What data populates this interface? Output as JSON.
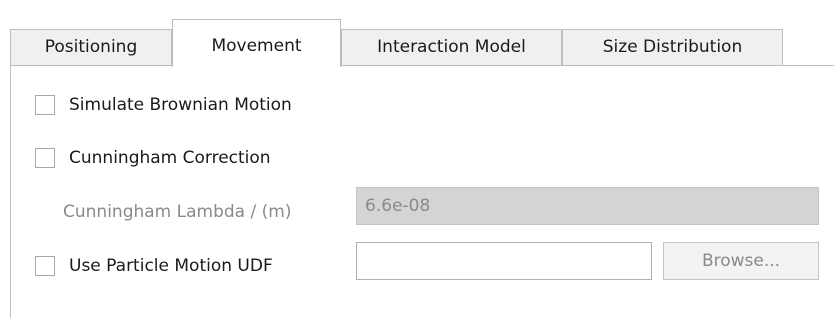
{
  "tabs": [
    {
      "label": "Positioning",
      "active": false
    },
    {
      "label": "Movement",
      "active": true
    },
    {
      "label": "Interaction Model",
      "active": false
    },
    {
      "label": "Size Distribution",
      "active": false
    }
  ],
  "movement": {
    "brownian": {
      "label": "Simulate Brownian Motion",
      "checked": false
    },
    "cunningham": {
      "label": "Cunningham Correction",
      "checked": false
    },
    "lambda": {
      "label": "Cunningham Lambda / (m)",
      "value": "6.6e-08"
    },
    "udf": {
      "label": "Use Particle Motion UDF",
      "checked": false,
      "value": "",
      "browse_label": "Browse..."
    }
  }
}
